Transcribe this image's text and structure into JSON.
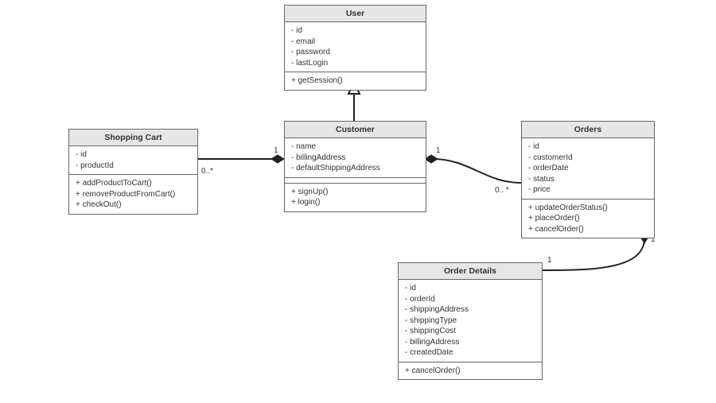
{
  "classes": {
    "user": {
      "name": "User",
      "attrs": [
        "- id",
        "- email",
        "- password",
        "- lastLogin"
      ],
      "ops": [
        "+ getSession()"
      ]
    },
    "customer": {
      "name": "Customer",
      "attrs": [
        "- name",
        "- billingAddress",
        "- defaultShippingAddress"
      ],
      "ops": [
        "+ signUp()",
        "+ login()"
      ]
    },
    "cart": {
      "name": "Shopping Cart",
      "attrs": [
        "- id",
        "- productId"
      ],
      "ops": [
        "+ addProductToCart()",
        "+ removeProductFromCart()",
        "+ checkOut()"
      ]
    },
    "orders": {
      "name": "Orders",
      "attrs": [
        "- id",
        "- customerId",
        "- orderDate",
        "- status",
        "- price"
      ],
      "ops": [
        "+ updateOrderStatus()",
        "+ placeOrder()",
        "+ cancelOrder()"
      ]
    },
    "orderdetails": {
      "name": "Order Details",
      "attrs": [
        "- id",
        "- orderId",
        "- shippingAddress",
        "- shippingType",
        "- shippingCost",
        "- billingAddress",
        "- createdDate"
      ],
      "ops": [
        "+ cancelOrder()"
      ]
    }
  },
  "relations": [
    {
      "from": "customer",
      "to": "user",
      "type": "generalization"
    },
    {
      "from": "customer",
      "to": "cart",
      "type": "composition",
      "from_mult": "1",
      "to_mult": "0..*"
    },
    {
      "from": "customer",
      "to": "orders",
      "type": "composition",
      "from_mult": "1",
      "to_mult": "0.. *"
    },
    {
      "from": "orders",
      "to": "orderdetails",
      "type": "composition",
      "from_mult": "1",
      "to_mult": "1"
    }
  ],
  "labels": {
    "cust_cart_one": "1",
    "cust_cart_many": "0..*",
    "cust_orders_one": "1",
    "cust_orders_many": "0.. *",
    "orders_det_one_a": "1",
    "orders_det_one_b": "1"
  }
}
